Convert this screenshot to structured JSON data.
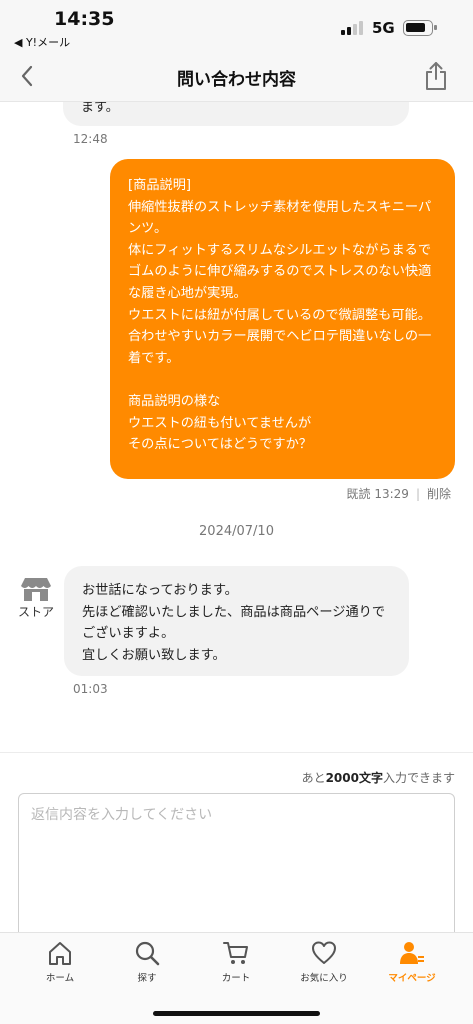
{
  "status_bar": {
    "time": "14:35",
    "back_app": "◀ Y!メール",
    "network": "5G"
  },
  "nav": {
    "title": "問い合わせ内容",
    "back_icon": "chevron-left-icon",
    "share_icon": "share-icon"
  },
  "messages": {
    "prev_fragment": "ます。",
    "prev_time": "12:48",
    "outgoing_text": "[商品説明]\n伸縮性抜群のストレッチ素材を使用したスキニーパンツ。\n体にフィットするスリムなシルエットながらまるでゴムのように伸び縮みするのでストレスのない快適な履き心地が実現。\nウエストには紐が付属しているので微調整も可能。\n合わせやすいカラー展開でヘビロテ間違いなしの一着です。\n\n商品説明の様な\nウエストの紐も付いてませんが\nその点についてはどうですか？",
    "outgoing_read": "既読 13:29",
    "delete_label": "削除",
    "date_separator": "2024/07/10",
    "store_label": "ストア",
    "incoming_text": "お世話になっております。\n先ほど確認いたしました、商品は商品ページ通りでございますよ。\n宜しくお願い致します。",
    "incoming_time": "01:03"
  },
  "input": {
    "count_prefix": "あと",
    "count_number": "2000文字",
    "count_suffix": "入力できます",
    "placeholder": "返信内容を入力してください"
  },
  "tabs": [
    {
      "label": "ホーム",
      "icon": "home-icon"
    },
    {
      "label": "探す",
      "icon": "search-icon"
    },
    {
      "label": "カート",
      "icon": "cart-icon"
    },
    {
      "label": "お気に入り",
      "icon": "heart-icon"
    },
    {
      "label": "マイページ",
      "icon": "person-icon",
      "active": true
    }
  ],
  "colors": {
    "accent": "#ff8a00",
    "bubble_incoming": "#f2f2f2"
  }
}
